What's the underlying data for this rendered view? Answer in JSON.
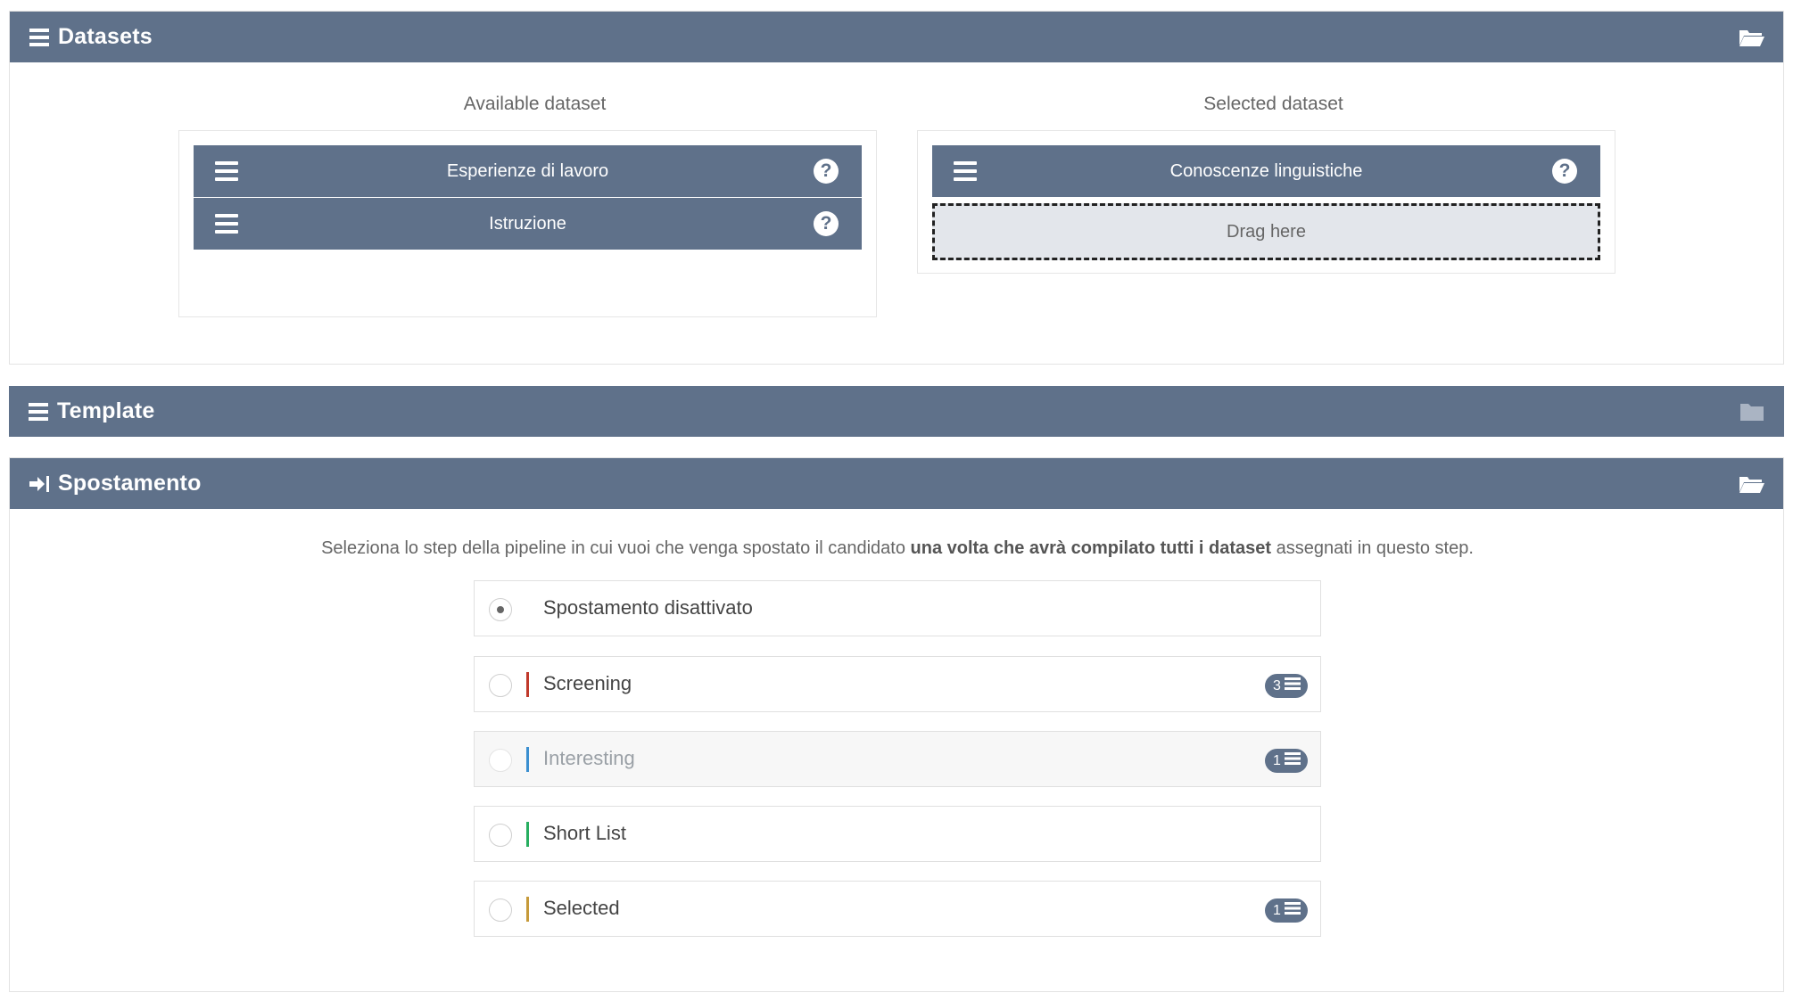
{
  "colors": {
    "header": "#5f718a",
    "screening": "#c0392b",
    "interesting": "#3b8fd0",
    "shortlist": "#27ae60",
    "selected": "#c69a3a"
  },
  "datasets_panel": {
    "title": "Datasets",
    "icon": "list-icon",
    "collapse_icon": "folder-open-icon",
    "available_title": "Available dataset",
    "selected_title": "Selected dataset",
    "available": [
      {
        "label": "Esperienze di lavoro",
        "help": "?"
      },
      {
        "label": "Istruzione",
        "help": "?"
      }
    ],
    "selected": [
      {
        "label": "Conoscenze linguistiche",
        "help": "?"
      }
    ],
    "dropzone": "Drag here"
  },
  "template_panel": {
    "title": "Template",
    "icon": "list-icon",
    "collapse_icon": "folder-closed-icon"
  },
  "spostamento_panel": {
    "title": "Spostamento",
    "icon": "sign-in-icon",
    "collapse_icon": "folder-open-icon",
    "desc_before": "Seleziona lo step della pipeline in cui vuoi che venga spostato il candidato ",
    "desc_bold": "una volta che avrà compilato tutti i dataset",
    "desc_after": " assegnati in questo step.",
    "options": [
      {
        "label": "Spostamento disattivato",
        "checked": true,
        "badge": ""
      },
      {
        "label": "Screening",
        "checked": false,
        "badge": "3"
      },
      {
        "label": "Interesting",
        "checked": false,
        "badge": "1",
        "disabled": true
      },
      {
        "label": "Short List",
        "checked": false,
        "badge": ""
      },
      {
        "label": "Selected",
        "checked": false,
        "badge": "1"
      }
    ]
  }
}
